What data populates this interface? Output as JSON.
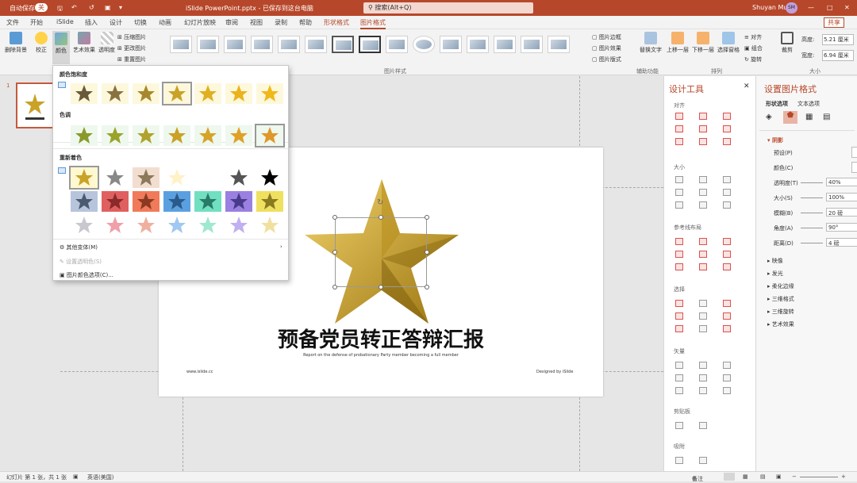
{
  "titlebar": {
    "autosave": "自动保存",
    "toggle": "关",
    "doc": "iSlide PowerPoint.pptx - 已保存到这台电脑",
    "search": "搜索(Alt+Q)",
    "user": "Shuyan Mu",
    "initials": "SM"
  },
  "tabs": [
    "文件",
    "开始",
    "iSlide",
    "插入",
    "设计",
    "切换",
    "动画",
    "幻灯片放映",
    "审阅",
    "视图",
    "录制",
    "帮助",
    "形状格式",
    "图片格式"
  ],
  "share": "共享",
  "ribbon": {
    "remove_bg": "删除背景",
    "correct": "校正",
    "color": "颜色",
    "artistic": "艺术效果",
    "transparency": "透明度",
    "compress": "压缩图片",
    "change": "更改图片",
    "reset": "重置图片",
    "border": "图片边框",
    "effects": "图片效果",
    "layout": "图片版式",
    "alt_text": "替换文字",
    "bring_forward": "上移一层",
    "send_backward": "下移一层",
    "selection_pane": "选择窗格",
    "align": "对齐",
    "group": "组合",
    "rotate": "旋转",
    "crop": "裁剪",
    "height_label": "高度:",
    "height_val": "5.21 厘米",
    "width_label": "宽度:",
    "width_val": "6.94 厘米",
    "grp_styles": "图片样式",
    "grp_access": "辅助功能",
    "grp_arrange": "排列",
    "grp_size": "大小"
  },
  "dropdown": {
    "sat_title": "颜色饱和度",
    "tone_title": "色调",
    "recolor_title": "重新着色",
    "more": "其他变体(M)",
    "set_transparent": "设置透明色(S)",
    "options": "图片颜色选项(C)..."
  },
  "slide": {
    "title": "预备党员转正答辩汇报",
    "subtitle": "Report on the defense of probationary Party member becoming a  full member",
    "left_footer": "www.islide.cc",
    "right_footer": "Designed by iSlide",
    "num": "1"
  },
  "design": {
    "title": "设计工具",
    "align": "对齐",
    "size": "大小",
    "guides": "参考线布局",
    "select": "选择",
    "vector": "矢量",
    "clipboard": "剪贴板",
    "extra": "吸附"
  },
  "format": {
    "title": "设置图片格式",
    "tab1": "形状选项",
    "tab2": "文本选项",
    "shadow": "阴影",
    "preset": "预设(P)",
    "color": "颜色(C)",
    "transparency": "透明度(T)",
    "transparency_val": "40%",
    "size": "大小(S)",
    "size_val": "100%",
    "blur": "模糊(B)",
    "blur_val": "20 磅",
    "angle": "角度(A)",
    "angle_val": "90°",
    "distance": "距离(D)",
    "distance_val": "4 磅",
    "sections": [
      "映像",
      "发光",
      "柔化边缘",
      "三维格式",
      "三维旋转",
      "艺术效果"
    ]
  },
  "status": {
    "slide": "幻灯片 第 1 张，共 1 张",
    "lang": "英语(美国)",
    "notes": "备注"
  },
  "colors": {
    "accent": "#b7472a",
    "gold": "#c9a227"
  }
}
